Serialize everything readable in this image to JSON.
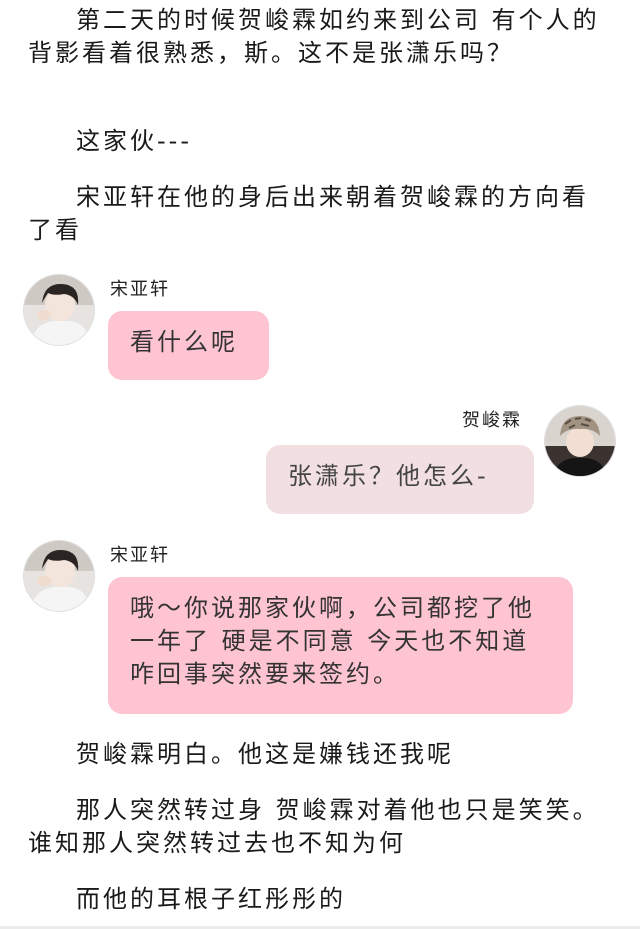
{
  "paragraphs": [
    "第二天的时候贺峻霖如约来到公司 有个人的背影看着很熟悉，斯。这不是张潇乐吗？",
    "这家伙---",
    "宋亚轩在他的身后出来朝着贺峻霖的方向看了看",
    "贺峻霖明白。他这是嫌钱还我呢",
    "那人突然转过身 贺峻霖对着他也只是笑笑。谁知那人突然转过去也不知为何",
    "而他的耳根子红彤彤的"
  ],
  "messages": [
    {
      "sender": "宋亚轩",
      "text": "看什么呢",
      "side": "left",
      "avatar": "avatar-boy-icon"
    },
    {
      "sender": "贺峻霖",
      "text": "张潇乐？他怎么-",
      "side": "right",
      "avatar": "avatar-hat-icon"
    },
    {
      "sender": "宋亚轩",
      "text": "哦～你说那家伙啊，公司都挖了他一年了 硬是不同意 今天也不知道咋回事突然要来签约。",
      "side": "left",
      "avatar": "avatar-boy-icon"
    }
  ],
  "colors": {
    "left_bubble": "#ffc4d1",
    "right_bubble": "#f2dfe2",
    "text": "#1a1a1a"
  }
}
